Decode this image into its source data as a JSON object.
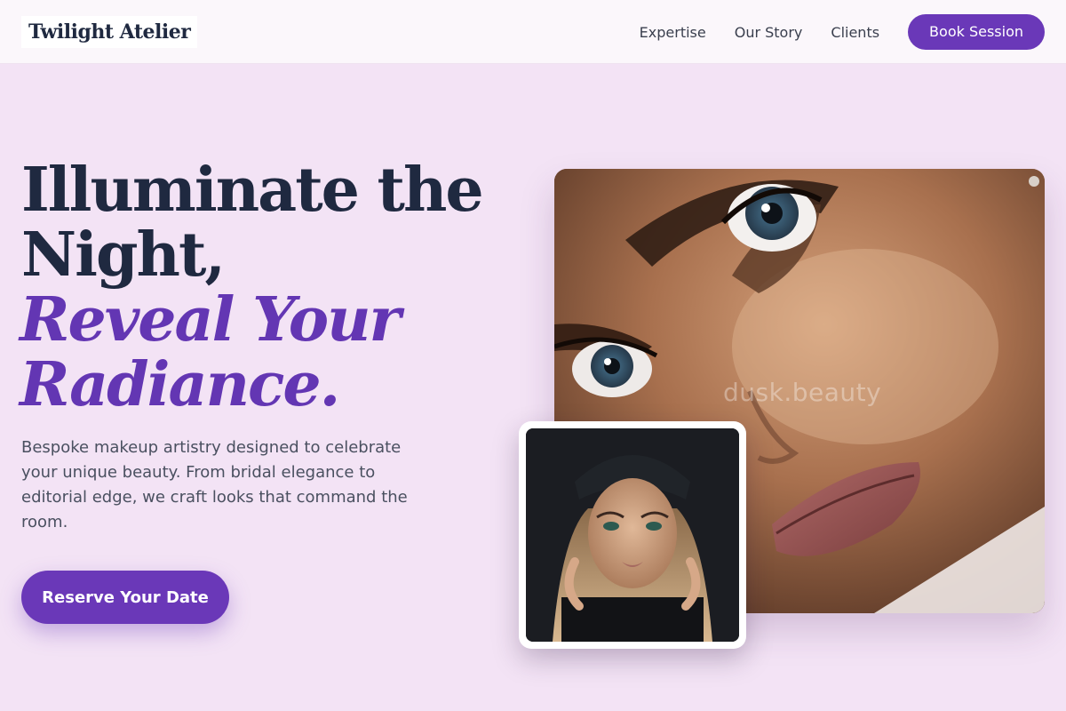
{
  "brand": {
    "name": "Twilight Atelier"
  },
  "nav": {
    "links": [
      "Expertise",
      "Our Story",
      "Clients"
    ],
    "cta_label": "Book Session"
  },
  "hero": {
    "headline_line1": "Illuminate the",
    "headline_line2": "Night,",
    "accent_line1": "Reveal Your",
    "accent_line2": "Radiance.",
    "description": "Bespoke makeup artistry designed to celebrate your unique beauty. From bridal elegance to editorial edge, we craft looks that command the room.",
    "cta_label": "Reserve Your Date"
  },
  "images": {
    "main_watermark": "dusk.beauty"
  },
  "colors": {
    "accent": "#6a38b8",
    "background": "#f3e3f5",
    "heading": "#1f2940"
  }
}
